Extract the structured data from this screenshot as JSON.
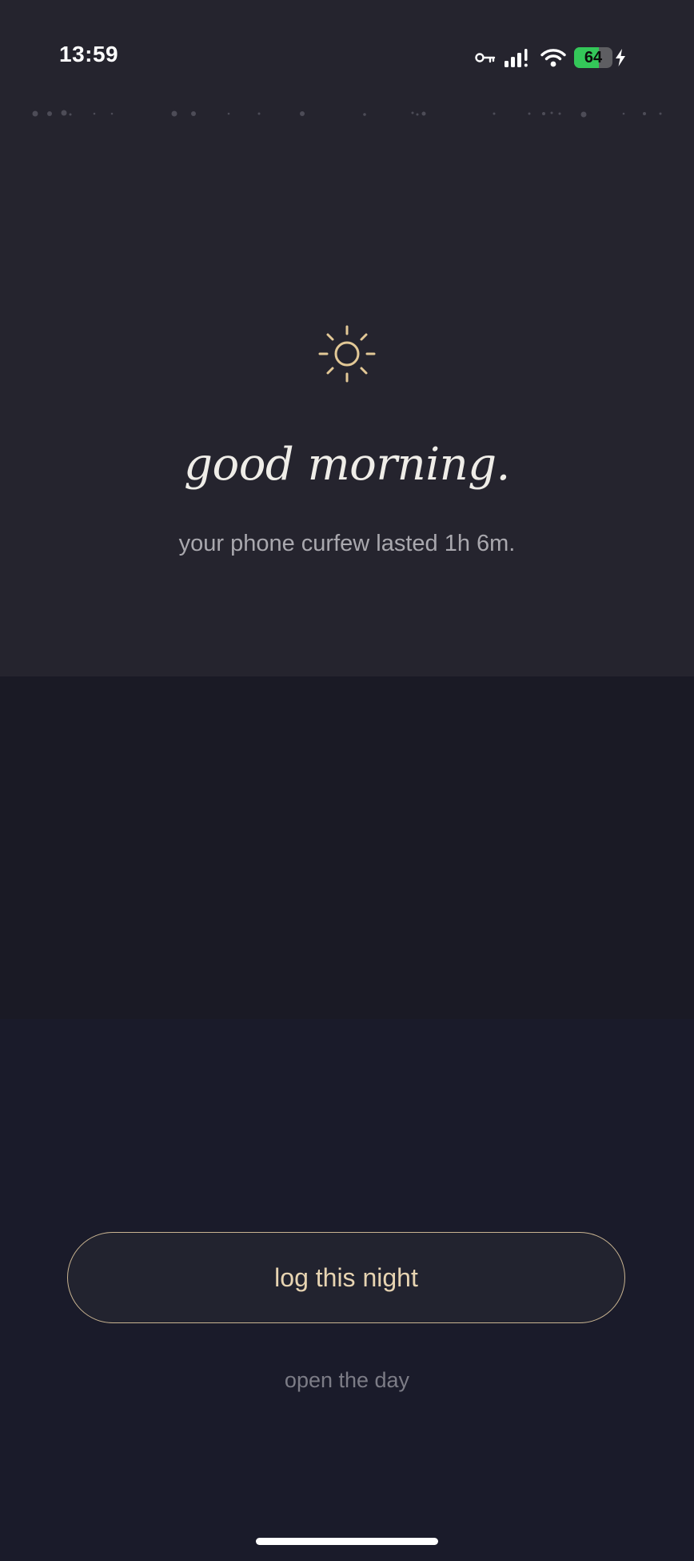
{
  "status_bar": {
    "time": "13:59",
    "icons": [
      "vpn-key-icon",
      "cellular-signal-icon",
      "wifi-icon",
      "battery-icon",
      "charging-bolt-icon"
    ],
    "battery_percent": "64",
    "battery_level": 0.64
  },
  "main": {
    "icon": "sun-icon",
    "greeting": "good morning.",
    "subtitle": "your phone curfew lasted 1h 6m."
  },
  "actions": {
    "primary_label": "log this night",
    "secondary_label": "open the day"
  },
  "colors": {
    "accent": "#e7d4b2",
    "top_background": "#25242e",
    "middle_background": "#1a1a25",
    "bottom_background": "#1a1b2a",
    "battery_green": "#34c759"
  }
}
